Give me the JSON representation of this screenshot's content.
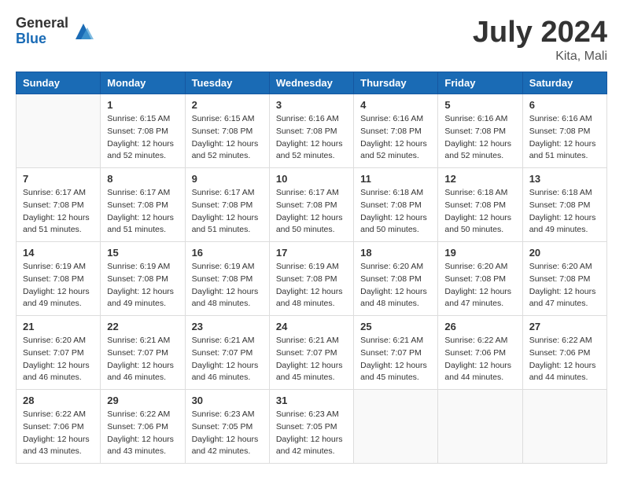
{
  "header": {
    "logo_general": "General",
    "logo_blue": "Blue",
    "title": "July 2024",
    "location": "Kita, Mali"
  },
  "days_of_week": [
    "Sunday",
    "Monday",
    "Tuesday",
    "Wednesday",
    "Thursday",
    "Friday",
    "Saturday"
  ],
  "weeks": [
    [
      {
        "day": "",
        "info": ""
      },
      {
        "day": "1",
        "info": "Sunrise: 6:15 AM\nSunset: 7:08 PM\nDaylight: 12 hours\nand 52 minutes."
      },
      {
        "day": "2",
        "info": "Sunrise: 6:15 AM\nSunset: 7:08 PM\nDaylight: 12 hours\nand 52 minutes."
      },
      {
        "day": "3",
        "info": "Sunrise: 6:16 AM\nSunset: 7:08 PM\nDaylight: 12 hours\nand 52 minutes."
      },
      {
        "day": "4",
        "info": "Sunrise: 6:16 AM\nSunset: 7:08 PM\nDaylight: 12 hours\nand 52 minutes."
      },
      {
        "day": "5",
        "info": "Sunrise: 6:16 AM\nSunset: 7:08 PM\nDaylight: 12 hours\nand 52 minutes."
      },
      {
        "day": "6",
        "info": "Sunrise: 6:16 AM\nSunset: 7:08 PM\nDaylight: 12 hours\nand 51 minutes."
      }
    ],
    [
      {
        "day": "7",
        "info": "Sunrise: 6:17 AM\nSunset: 7:08 PM\nDaylight: 12 hours\nand 51 minutes."
      },
      {
        "day": "8",
        "info": "Sunrise: 6:17 AM\nSunset: 7:08 PM\nDaylight: 12 hours\nand 51 minutes."
      },
      {
        "day": "9",
        "info": "Sunrise: 6:17 AM\nSunset: 7:08 PM\nDaylight: 12 hours\nand 51 minutes."
      },
      {
        "day": "10",
        "info": "Sunrise: 6:17 AM\nSunset: 7:08 PM\nDaylight: 12 hours\nand 50 minutes."
      },
      {
        "day": "11",
        "info": "Sunrise: 6:18 AM\nSunset: 7:08 PM\nDaylight: 12 hours\nand 50 minutes."
      },
      {
        "day": "12",
        "info": "Sunrise: 6:18 AM\nSunset: 7:08 PM\nDaylight: 12 hours\nand 50 minutes."
      },
      {
        "day": "13",
        "info": "Sunrise: 6:18 AM\nSunset: 7:08 PM\nDaylight: 12 hours\nand 49 minutes."
      }
    ],
    [
      {
        "day": "14",
        "info": "Sunrise: 6:19 AM\nSunset: 7:08 PM\nDaylight: 12 hours\nand 49 minutes."
      },
      {
        "day": "15",
        "info": "Sunrise: 6:19 AM\nSunset: 7:08 PM\nDaylight: 12 hours\nand 49 minutes."
      },
      {
        "day": "16",
        "info": "Sunrise: 6:19 AM\nSunset: 7:08 PM\nDaylight: 12 hours\nand 48 minutes."
      },
      {
        "day": "17",
        "info": "Sunrise: 6:19 AM\nSunset: 7:08 PM\nDaylight: 12 hours\nand 48 minutes."
      },
      {
        "day": "18",
        "info": "Sunrise: 6:20 AM\nSunset: 7:08 PM\nDaylight: 12 hours\nand 48 minutes."
      },
      {
        "day": "19",
        "info": "Sunrise: 6:20 AM\nSunset: 7:08 PM\nDaylight: 12 hours\nand 47 minutes."
      },
      {
        "day": "20",
        "info": "Sunrise: 6:20 AM\nSunset: 7:08 PM\nDaylight: 12 hours\nand 47 minutes."
      }
    ],
    [
      {
        "day": "21",
        "info": "Sunrise: 6:20 AM\nSunset: 7:07 PM\nDaylight: 12 hours\nand 46 minutes."
      },
      {
        "day": "22",
        "info": "Sunrise: 6:21 AM\nSunset: 7:07 PM\nDaylight: 12 hours\nand 46 minutes."
      },
      {
        "day": "23",
        "info": "Sunrise: 6:21 AM\nSunset: 7:07 PM\nDaylight: 12 hours\nand 46 minutes."
      },
      {
        "day": "24",
        "info": "Sunrise: 6:21 AM\nSunset: 7:07 PM\nDaylight: 12 hours\nand 45 minutes."
      },
      {
        "day": "25",
        "info": "Sunrise: 6:21 AM\nSunset: 7:07 PM\nDaylight: 12 hours\nand 45 minutes."
      },
      {
        "day": "26",
        "info": "Sunrise: 6:22 AM\nSunset: 7:06 PM\nDaylight: 12 hours\nand 44 minutes."
      },
      {
        "day": "27",
        "info": "Sunrise: 6:22 AM\nSunset: 7:06 PM\nDaylight: 12 hours\nand 44 minutes."
      }
    ],
    [
      {
        "day": "28",
        "info": "Sunrise: 6:22 AM\nSunset: 7:06 PM\nDaylight: 12 hours\nand 43 minutes."
      },
      {
        "day": "29",
        "info": "Sunrise: 6:22 AM\nSunset: 7:06 PM\nDaylight: 12 hours\nand 43 minutes."
      },
      {
        "day": "30",
        "info": "Sunrise: 6:23 AM\nSunset: 7:05 PM\nDaylight: 12 hours\nand 42 minutes."
      },
      {
        "day": "31",
        "info": "Sunrise: 6:23 AM\nSunset: 7:05 PM\nDaylight: 12 hours\nand 42 minutes."
      },
      {
        "day": "",
        "info": ""
      },
      {
        "day": "",
        "info": ""
      },
      {
        "day": "",
        "info": ""
      }
    ]
  ]
}
